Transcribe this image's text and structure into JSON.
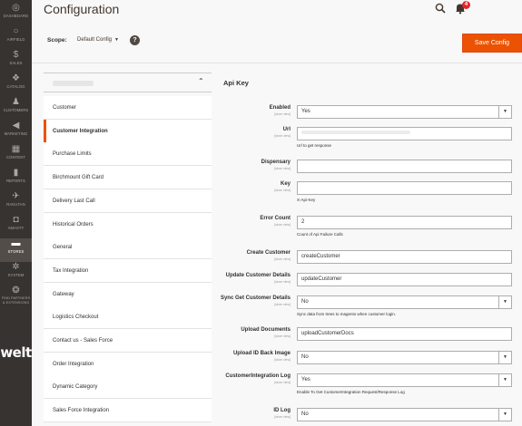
{
  "nav": {
    "items": [
      {
        "label": "DASHBOARD",
        "icon": "dashboard-icon",
        "glyph": "◎"
      },
      {
        "label": "AIRFIELD",
        "icon": "airfield-icon",
        "glyph": "○"
      },
      {
        "label": "SALES",
        "icon": "dollar-icon",
        "glyph": "$"
      },
      {
        "label": "CATALOG",
        "icon": "catalog-icon",
        "glyph": "❖"
      },
      {
        "label": "CUSTOMERS",
        "icon": "customers-icon",
        "glyph": "♟"
      },
      {
        "label": "MARKETING",
        "icon": "marketing-icon",
        "glyph": "◀"
      },
      {
        "label": "CONTENT",
        "icon": "content-icon",
        "glyph": "▦"
      },
      {
        "label": "REPORTS",
        "icon": "reports-icon",
        "glyph": "▮"
      },
      {
        "label": "RAKUTAN",
        "icon": "rakutan-icon",
        "glyph": "✈"
      },
      {
        "label": "AMASTY",
        "icon": "amasty-icon",
        "glyph": "◘"
      },
      {
        "label": "STORES",
        "icon": "stores-icon",
        "glyph": "▬"
      },
      {
        "label": "SYSTEM",
        "icon": "system-icon",
        "glyph": "✲"
      },
      {
        "label": "FIND PARTNERS & EXTENSIONS",
        "icon": "extensions-icon",
        "glyph": "❂"
      }
    ],
    "brand": "welt"
  },
  "header": {
    "title": "Configuration",
    "notification_count": "4"
  },
  "scope": {
    "label": "Scope:",
    "value": "Default Config",
    "help": "?",
    "save_label": "Save Config"
  },
  "sections": {
    "items": [
      "Customer",
      "Customer Integration",
      "Purchase Limits",
      "Birchmount Gift Card",
      "Delivery Last Call",
      "Historical Orders",
      "General",
      "Tax Integration",
      "Gateway",
      "Logistics Checkout",
      "Contact us - Sales Force",
      "Order Integration",
      "Dynamic Category",
      "Sales Force Integration"
    ],
    "active_index": 1
  },
  "panel": {
    "title": "Api Key",
    "scope_text": "[store view]",
    "fields": [
      {
        "label": "Enabled",
        "value": "Yes",
        "type": "select",
        "note": ""
      },
      {
        "label": "Url",
        "value": "",
        "type": "text-blurred",
        "note": "Url to get response"
      },
      {
        "label": "Dispensary",
        "value": "",
        "type": "text",
        "note": ""
      },
      {
        "label": "Key",
        "value": "",
        "type": "text",
        "note": "X-Api-Key"
      },
      {
        "label": "Error Count",
        "value": "2",
        "type": "text",
        "note": "Count of Api Failure Calls"
      },
      {
        "label": "Create Customer",
        "value": "createCustomer",
        "type": "text",
        "note": ""
      },
      {
        "label": "Update Customer Details",
        "value": "updateCustomer",
        "type": "text",
        "note": ""
      },
      {
        "label": "Sync Get Customer Details",
        "value": "No",
        "type": "select",
        "note": "Sync data from trees to magento when customer login."
      },
      {
        "label": "Upload Documents",
        "value": "uploadCustomerDocs",
        "type": "text",
        "note": ""
      },
      {
        "label": "Upload ID Back Image",
        "value": "No",
        "type": "select",
        "note": ""
      },
      {
        "label": "CustomerIntegration Log",
        "value": "Yes",
        "type": "select",
        "note": "Enable To Get CustomerIntegration Request/Response Log"
      },
      {
        "label": "ID Log",
        "value": "No",
        "type": "select",
        "note": ""
      }
    ]
  }
}
